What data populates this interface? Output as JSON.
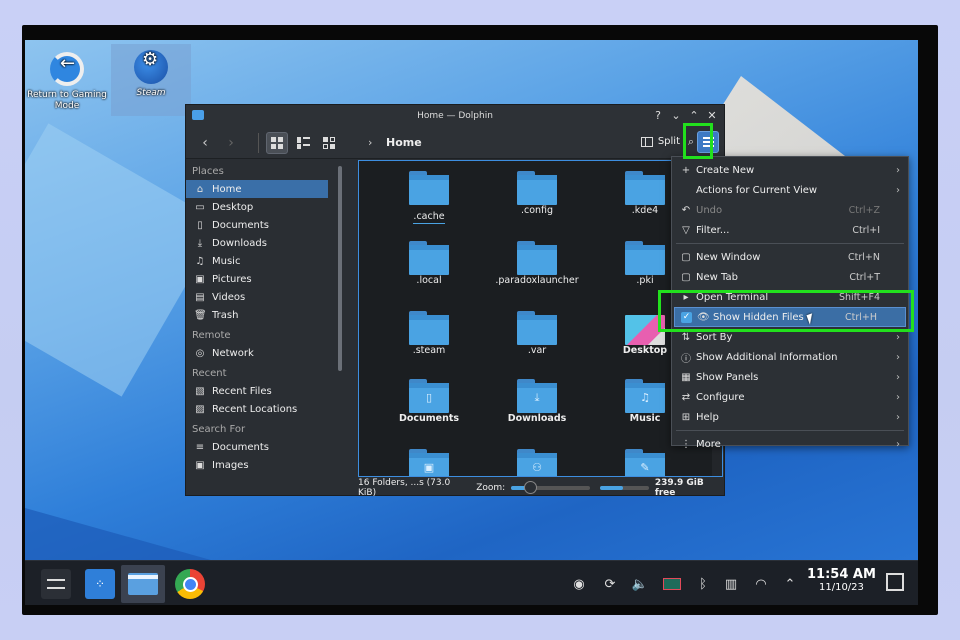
{
  "desktop": {
    "icons": [
      {
        "label": "Return to Gaming Mode",
        "icon": "return-arrow-icon"
      },
      {
        "label": "Steam",
        "icon": "steam-icon"
      }
    ]
  },
  "window": {
    "title": "Home — Dolphin",
    "title_buttons": [
      "?",
      "⌄",
      "⌃",
      "✕"
    ],
    "toolbar": {
      "back": "‹",
      "forward": "›",
      "breadcrumb_sep": "›",
      "location": "Home",
      "split_label": "Split",
      "search_glyph": "⌕"
    },
    "sidebar": {
      "sections": [
        {
          "title": "Places",
          "items": [
            {
              "label": "Home",
              "icon": "⌂",
              "selected": true
            },
            {
              "label": "Desktop",
              "icon": "▭"
            },
            {
              "label": "Documents",
              "icon": "▯"
            },
            {
              "label": "Downloads",
              "icon": "⤓"
            },
            {
              "label": "Music",
              "icon": "♫"
            },
            {
              "label": "Pictures",
              "icon": "▣"
            },
            {
              "label": "Videos",
              "icon": "▤"
            },
            {
              "label": "Trash",
              "icon": "🗑"
            }
          ]
        },
        {
          "title": "Remote",
          "items": [
            {
              "label": "Network",
              "icon": "◎"
            }
          ]
        },
        {
          "title": "Recent",
          "items": [
            {
              "label": "Recent Files",
              "icon": "▧"
            },
            {
              "label": "Recent Locations",
              "icon": "▨"
            }
          ]
        },
        {
          "title": "Search For",
          "items": [
            {
              "label": "Documents",
              "icon": "≡"
            },
            {
              "label": "Images",
              "icon": "▣"
            }
          ]
        }
      ]
    },
    "files": [
      {
        "name": ".cache",
        "current": true
      },
      {
        "name": ".config"
      },
      {
        "name": ".kde4"
      },
      {
        "name": ".local"
      },
      {
        "name": ".paradoxlauncher"
      },
      {
        "name": ".pki"
      },
      {
        "name": ".steam"
      },
      {
        "name": ".var"
      },
      {
        "name": "Desktop",
        "thumb": "desktop"
      },
      {
        "name": "Documents",
        "emblem": "▯"
      },
      {
        "name": "Downloads",
        "emblem": "⤓"
      },
      {
        "name": "Music",
        "emblem": "♫"
      },
      {
        "name": "",
        "emblem": "▣"
      },
      {
        "name": "",
        "emblem": "⚇"
      },
      {
        "name": "",
        "emblem": "✎"
      }
    ],
    "status": {
      "summary": "16 Folders, ...s (73.0 KiB)",
      "zoom_label": "Zoom:",
      "zoom_level": 0.22,
      "space_used_fraction": 0.45,
      "free_space": "239.9 GiB free"
    }
  },
  "menu": {
    "items": [
      {
        "label": "Create New",
        "icon": "+",
        "submenu": true
      },
      {
        "label": "Actions for Current View",
        "icon": "",
        "submenu": true
      },
      {
        "label": "Undo",
        "icon": "↶",
        "shortcut": "Ctrl+Z",
        "disabled": true
      },
      {
        "label": "Filter...",
        "icon": "▽",
        "shortcut": "Ctrl+I"
      },
      {
        "separator": true
      },
      {
        "label": "New Window",
        "icon": "▢",
        "shortcut": "Ctrl+N"
      },
      {
        "label": "New Tab",
        "icon": "▢",
        "shortcut": "Ctrl+T"
      },
      {
        "label": "Open Terminal",
        "icon": "▸",
        "shortcut": "Shift+F4"
      },
      {
        "label": "Show Hidden Files",
        "icon": "👁",
        "shortcut": "Ctrl+H",
        "checked": true,
        "highlighted": true
      },
      {
        "label": "Sort By",
        "icon": "⇅",
        "submenu": true
      },
      {
        "label": "Show Additional Information",
        "icon": "ⓘ",
        "submenu": true
      },
      {
        "label": "Show Panels",
        "icon": "▦",
        "submenu": true
      },
      {
        "label": "Configure",
        "icon": "⇄",
        "submenu": true
      },
      {
        "label": "Help",
        "icon": "⊞",
        "submenu": true
      },
      {
        "separator": true
      },
      {
        "label": "More",
        "icon": "⋮",
        "submenu": true
      }
    ],
    "submenu_glyph": "›"
  },
  "taskbar": {
    "apps": [
      "settings-app",
      "discover-store",
      "dolphin-file-manager",
      "chrome-browser"
    ],
    "tray": [
      "steam",
      "updates",
      "volume",
      "battery",
      "bluetooth",
      "usb-storage",
      "wifi",
      "expand"
    ],
    "time": "11:54 AM",
    "date": "11/10/23"
  },
  "colors": {
    "accent": "#3d8ee0",
    "highlight_annotation": "#22e01d",
    "menu_bg": "#2c3035"
  }
}
